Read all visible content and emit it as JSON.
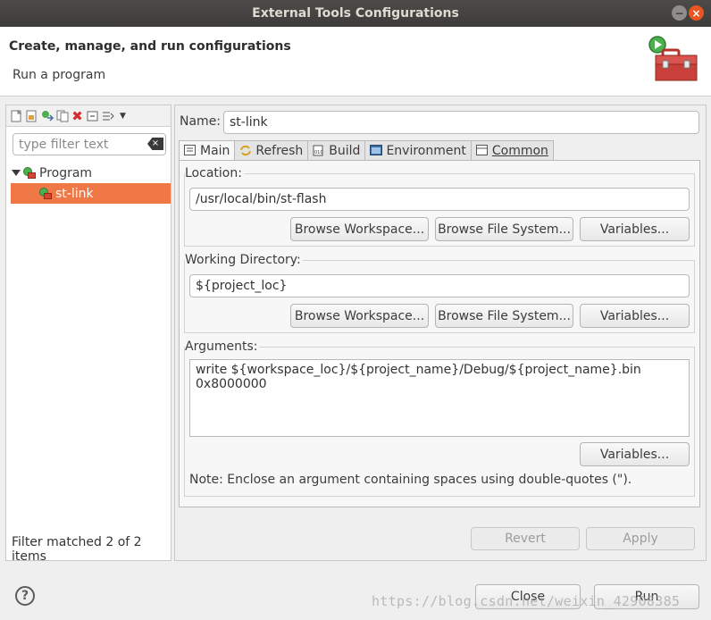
{
  "window": {
    "title": "External Tools Configurations"
  },
  "header": {
    "title": "Create, manage, and run configurations",
    "subtitle": "Run a program"
  },
  "left": {
    "filter_placeholder": "type filter text",
    "tree": {
      "parent": "Program",
      "child": "st-link"
    },
    "footer": "Filter matched 2 of 2 items"
  },
  "main": {
    "name_label": "Name:",
    "name_value": "st-link",
    "tabs": [
      "Main",
      "Refresh",
      "Build",
      "Environment",
      "Common"
    ],
    "location": {
      "label": "Location:",
      "value": "/usr/local/bin/st-flash",
      "browse_workspace": "Browse Workspace...",
      "browse_fs": "Browse File System...",
      "variables": "Variables..."
    },
    "working_dir": {
      "label": "Working Directory:",
      "value": "${project_loc}",
      "browse_workspace": "Browse Workspace...",
      "browse_fs": "Browse File System...",
      "variables": "Variables..."
    },
    "arguments": {
      "label": "Arguments:",
      "value": "write ${workspace_loc}/${project_name}/Debug/${project_name}.bin 0x8000000",
      "variables": "Variables...",
      "note": "Note: Enclose an argument containing spaces using double-quotes (\")."
    },
    "revert": "Revert",
    "apply": "Apply"
  },
  "footer": {
    "close": "Close",
    "run": "Run",
    "help_icon": "?",
    "watermark": "https://blog.csdn.net/weixin_42908385"
  },
  "colors": {
    "selection": "#f07746",
    "close_button": "#e95420"
  }
}
